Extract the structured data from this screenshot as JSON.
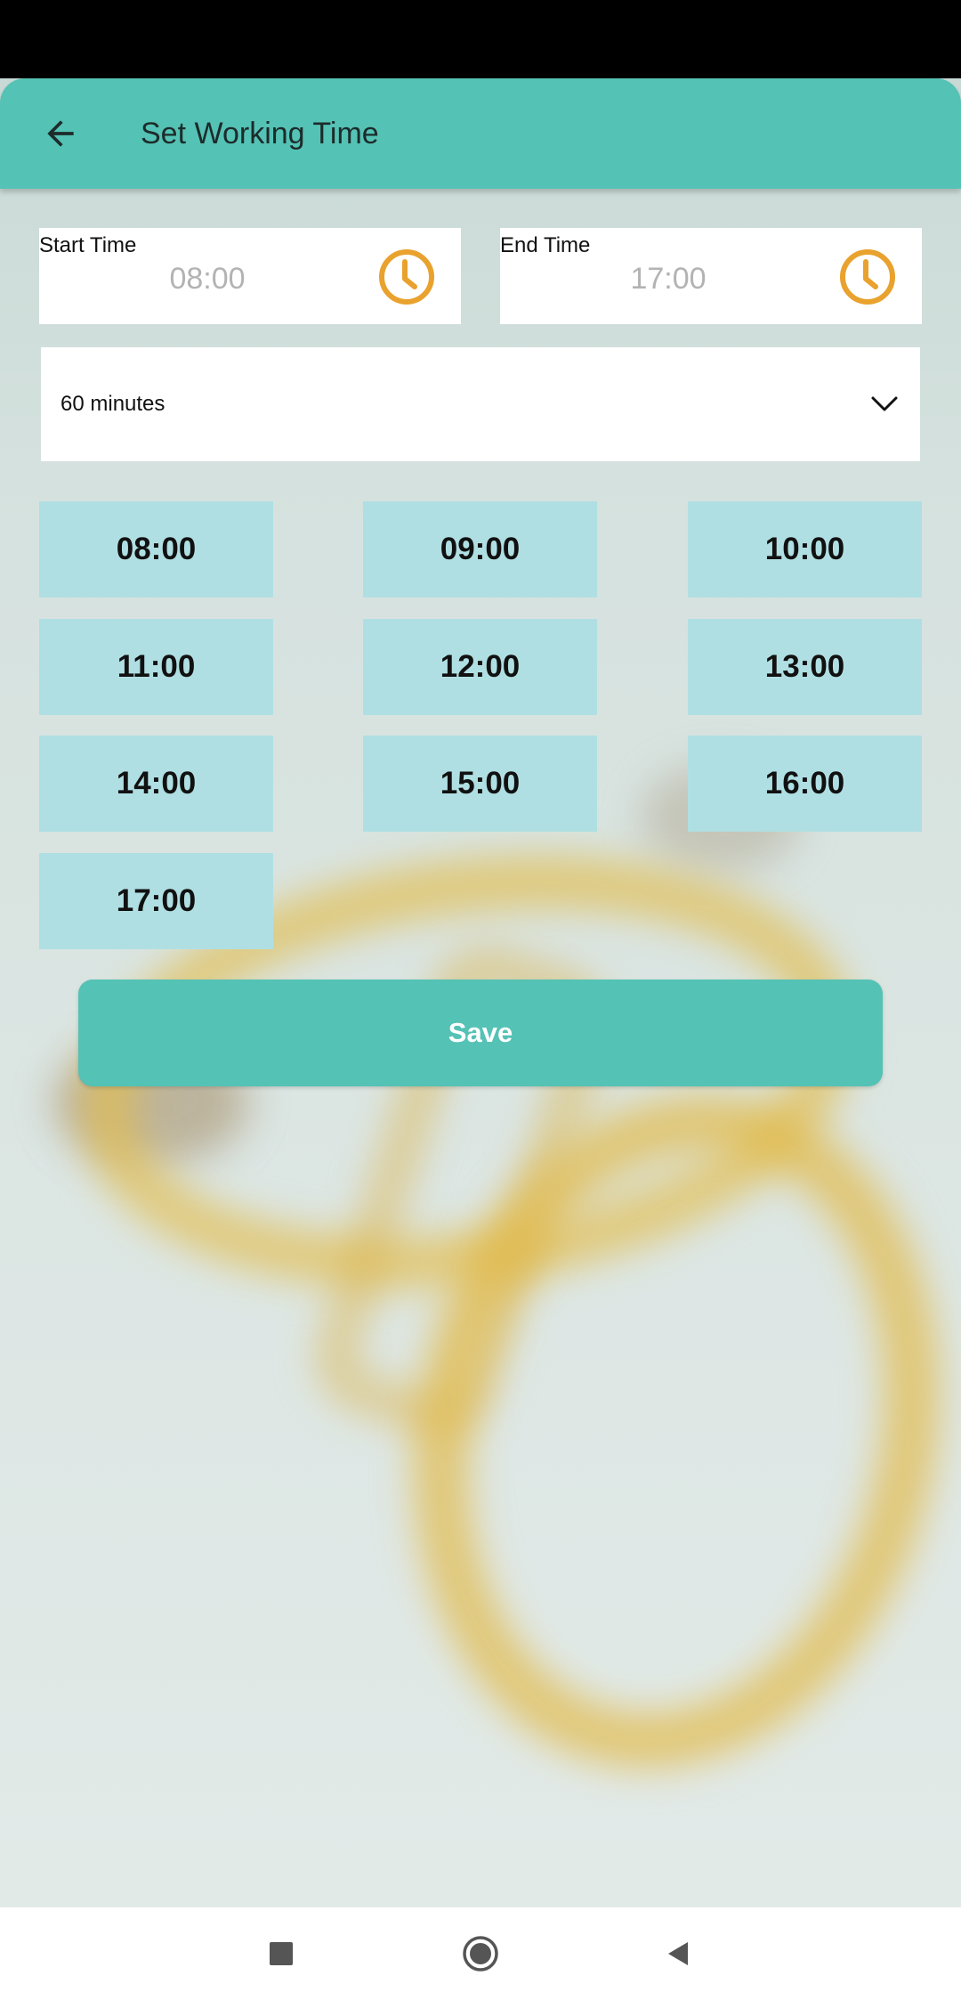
{
  "header": {
    "title": "Set Working Time",
    "back_icon": "arrow-left-icon"
  },
  "start_time": {
    "label": "Start Time",
    "value": "08:00",
    "icon": "clock-icon"
  },
  "end_time": {
    "label": "End Time",
    "value": "17:00",
    "icon": "clock-icon"
  },
  "duration_select": {
    "selected": "60 minutes",
    "icon": "chevron-down-icon"
  },
  "time_slots": [
    "08:00",
    "09:00",
    "10:00",
    "11:00",
    "12:00",
    "13:00",
    "14:00",
    "15:00",
    "16:00",
    "17:00"
  ],
  "save_label": "Save",
  "nav": {
    "recents_icon": "square-icon",
    "home_icon": "circle-icon",
    "back_icon": "triangle-back-icon"
  },
  "colors": {
    "primary": "#54c2b5",
    "slot": "#b0dfe3",
    "clock_accent": "#e9a22e",
    "placeholder_text": "#b3b3b3"
  }
}
